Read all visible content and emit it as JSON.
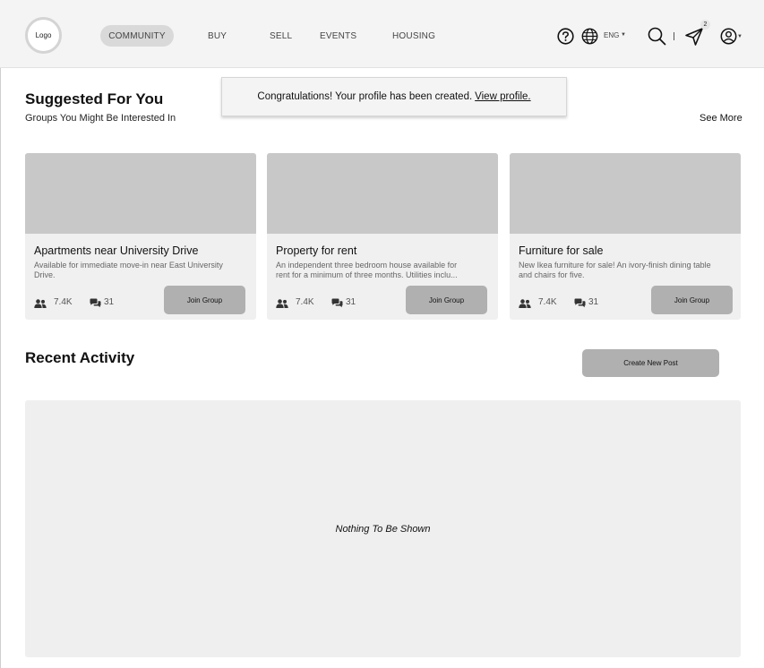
{
  "header": {
    "logo": "Logo",
    "nav": [
      {
        "label": "COMMUNITY",
        "active": true
      },
      {
        "label": "BUY"
      },
      {
        "label": "SELL"
      },
      {
        "label": "EVENTS"
      },
      {
        "label": "HOUSING"
      }
    ],
    "language": "ENG",
    "notification_count": "2",
    "icons": [
      "help-icon",
      "globe-icon",
      "search-icon",
      "send-icon",
      "user-icon"
    ]
  },
  "toast": {
    "message": "Congratulations! Your profile has been created.",
    "link": "View profile."
  },
  "suggested": {
    "title": "Suggested For You",
    "subtitle": "Groups You Might Be Interested In",
    "see_more": "See More",
    "cards": [
      {
        "title": "Apartments near University Drive",
        "description": "Available for immediate move-in near East University Drive.",
        "members": "7.4K",
        "posts": "31",
        "button": "Join Group"
      },
      {
        "title": "Property for rent",
        "description": "An independent three bedroom house available for rent for a minimum of three months. Utilities inclu...",
        "members": "7.4K",
        "posts": "31",
        "button": "Join Group"
      },
      {
        "title": "Furniture for sale",
        "description": "New Ikea furniture for sale! An ivory-finish dining table and chairs for five.",
        "members": "7.4K",
        "posts": "31",
        "button": "Join Group"
      }
    ]
  },
  "recent": {
    "title": "Recent Activity",
    "create_button": "Create New Post",
    "empty_message": "Nothing To Be Shown"
  },
  "colors": {
    "header_bg": "#f4f4f4",
    "card_bg": "#f0f0f0",
    "image_placeholder": "#c8c8c8",
    "button_bg": "#b0b0b0",
    "active_nav_bg": "#d9d9d9"
  }
}
